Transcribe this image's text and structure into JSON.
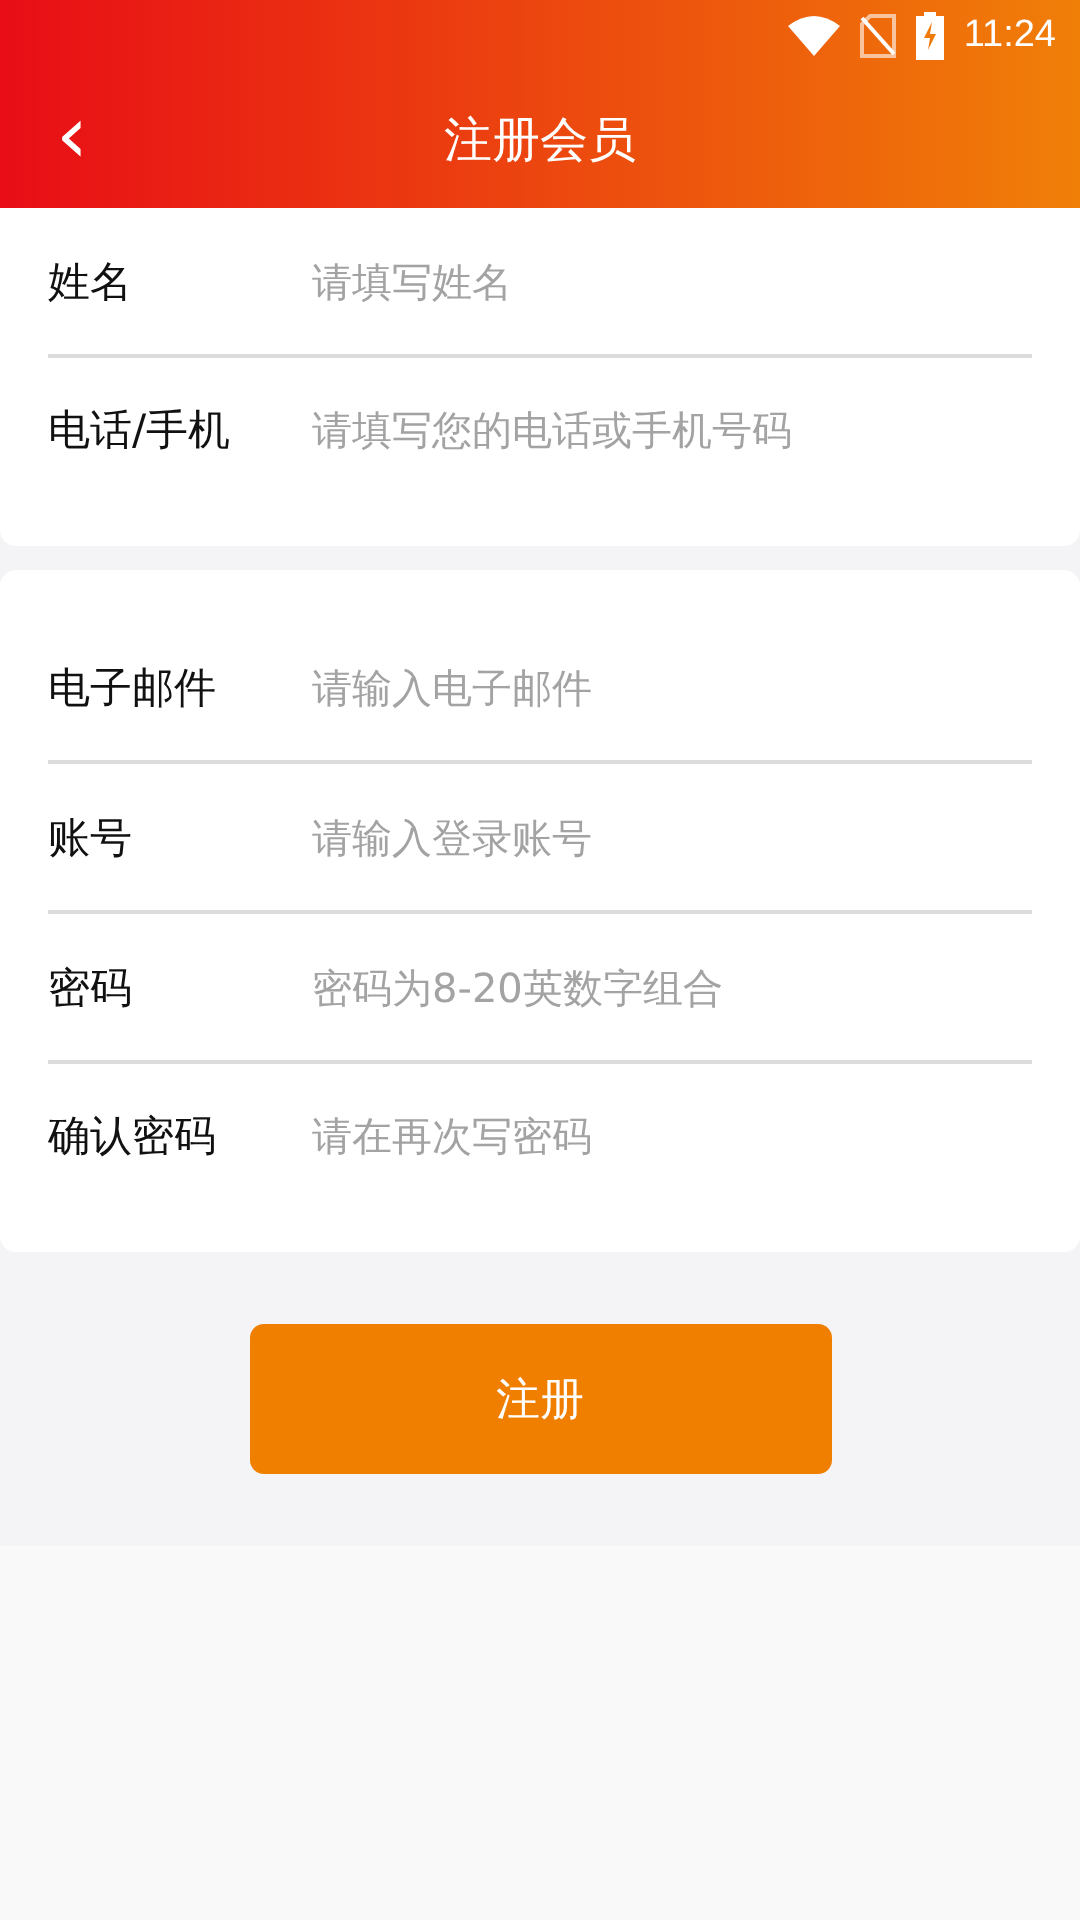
{
  "status_bar": {
    "time": "11:24"
  },
  "header": {
    "back": "‹",
    "title": "注册会员"
  },
  "sections": [
    {
      "fields": [
        {
          "label": "姓名",
          "placeholder": "请填写姓名"
        },
        {
          "label": "电话/手机",
          "placeholder": "请填写您的电话或手机号码"
        }
      ]
    },
    {
      "fields": [
        {
          "label": "电子邮件",
          "placeholder": "请输入电子邮件"
        },
        {
          "label": "账号",
          "placeholder": "请输入登录账号"
        },
        {
          "label": "密码",
          "placeholder": "密码为8-20英数字组合"
        },
        {
          "label": "确认密码",
          "placeholder": "请在再次写密码"
        }
      ]
    }
  ],
  "submit": "注册"
}
